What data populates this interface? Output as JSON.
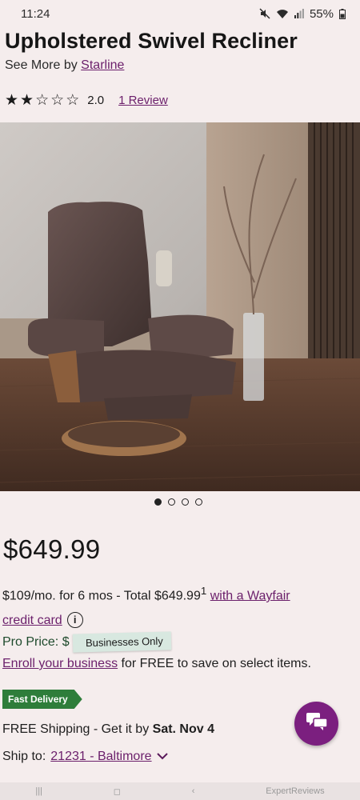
{
  "status": {
    "time": "11:24",
    "battery": "55%"
  },
  "product": {
    "title": "Upholstered Swivel Recliner",
    "see_more_prefix": "See More by",
    "brand": "Starline",
    "rating": "2.0",
    "rating_stars": 2,
    "reviews_link": "1 Review"
  },
  "gallery": {
    "count": 4,
    "active": 1
  },
  "pricing": {
    "price": "$649.99",
    "financing_text": "$109/mo. for 6 mos - Total $649.99",
    "financing_sup": "1",
    "financing_link_1": "with a Wayfair",
    "financing_link_2": "credit card",
    "info_icon": "i"
  },
  "pro": {
    "label": "Pro Price: $",
    "badge": "Businesses Only",
    "enroll_link": "Enroll your business",
    "enroll_rest": " for FREE to save on select items."
  },
  "delivery": {
    "badge": "Fast Delivery",
    "shipping_prefix": "FREE Shipping - Get it by ",
    "shipping_date": "Sat. Nov 4",
    "ship_to_label": "Ship to:",
    "ship_to_location": "21231 - Baltimore"
  },
  "nav": {
    "right_text": "ExpertReviews"
  },
  "colors": {
    "accent": "#6b1f6b",
    "fab": "#7b1f7f",
    "fast_delivery": "#2e7d3a"
  }
}
